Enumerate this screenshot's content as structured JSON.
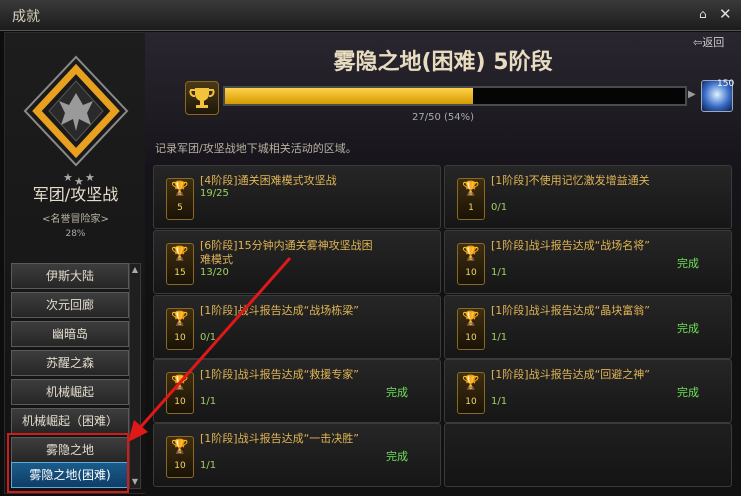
{
  "window": {
    "title": "成就"
  },
  "left": {
    "category_title": "军团/攻坚战",
    "category_subtitle": "<名誉冒险家>",
    "category_percent": "28%",
    "nav": [
      {
        "label": "伊斯大陆"
      },
      {
        "label": "次元回廊"
      },
      {
        "label": "幽暗岛"
      },
      {
        "label": "苏醒之森"
      },
      {
        "label": "机械崛起"
      },
      {
        "label": "机械崛起（困难）"
      },
      {
        "label": "雾隐之地"
      },
      {
        "label": "雾隐之地(困难)"
      }
    ]
  },
  "main": {
    "back_label": "返回",
    "header_title": "雾隐之地(困难) 5阶段",
    "progress_value": 27,
    "progress_max": 50,
    "progress_text": "27/50 (54%)",
    "reward_count": "150",
    "description": "记录军团/攻坚战地下城相关活动的区域。",
    "cards": [
      {
        "level": "5",
        "name": "[4阶段]通关困难模式攻坚战",
        "progress": "19/25",
        "status": ""
      },
      {
        "level": "1",
        "name": "[1阶段]不使用记忆激发增益通关",
        "progress": "0/1",
        "status": ""
      },
      {
        "level": "15",
        "name": "[6阶段]15分钟内通关雾神攻坚战困难模式",
        "progress": "13/20",
        "status": ""
      },
      {
        "level": "10",
        "name": "[1阶段]战斗报告达成“战场名将”",
        "progress": "1/1",
        "status": "完成"
      },
      {
        "level": "10",
        "name": "[1阶段]战斗报告达成“战场栋梁”",
        "progress": "0/1",
        "status": ""
      },
      {
        "level": "10",
        "name": "[1阶段]战斗报告达成“晶块富翁”",
        "progress": "1/1",
        "status": "完成"
      },
      {
        "level": "10",
        "name": "[1阶段]战斗报告达成“救援专家”",
        "progress": "1/1",
        "status": "完成"
      },
      {
        "level": "10",
        "name": "[1阶段]战斗报告达成“回避之神”",
        "progress": "1/1",
        "status": "完成"
      },
      {
        "level": "10",
        "name": "[1阶段]战斗报告达成“一击决胜”",
        "progress": "1/1",
        "status": "完成"
      }
    ]
  },
  "icons": {
    "home": "home-icon",
    "close": "close-icon",
    "back": "back-arrow-icon",
    "trophy": "trophy-icon",
    "reward": "reward-item-icon"
  },
  "colors": {
    "progress_fill": "#f0b814",
    "complete_text": "#6ee05a",
    "highlight_box": "#d21e1e",
    "selected_nav": "#1a5c8a"
  }
}
